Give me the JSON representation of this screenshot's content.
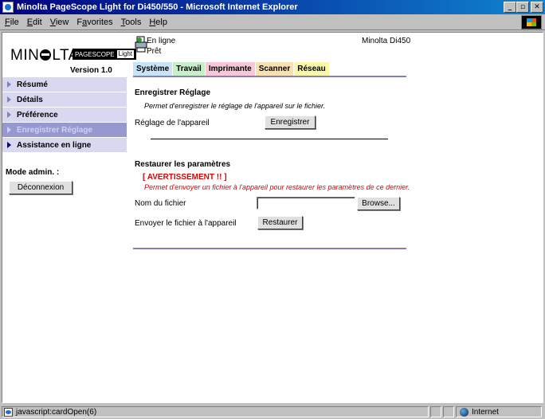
{
  "window": {
    "title": "Minolta PageScope Light for Di450/550 - Microsoft Internet Explorer"
  },
  "menu": [
    {
      "label": "File",
      "u": "F",
      "rest": "ile"
    },
    {
      "label": "Edit",
      "u": "E",
      "rest": "dit"
    },
    {
      "label": "View",
      "u": "V",
      "rest": "iew"
    },
    {
      "label": "Favorites",
      "pre": "F",
      "u": "a",
      "rest": "vorites"
    },
    {
      "label": "Tools",
      "u": "T",
      "rest": "ools"
    },
    {
      "label": "Help",
      "u": "H",
      "rest": "elp"
    }
  ],
  "header": {
    "logo_pre": "MIN",
    "logo_post": "LTA",
    "badge": "PAGESCOPE",
    "badge_light": "Light",
    "version": "Version 1.0",
    "status_line1": "En ligne",
    "status_line2": "Prêt",
    "model": "Minolta Di450"
  },
  "sidebar": {
    "items": [
      {
        "label": "Résumé"
      },
      {
        "label": "Détails"
      },
      {
        "label": "Préférence"
      },
      {
        "label": "Enregistrer Réglage"
      },
      {
        "label": "Assistance en ligne"
      }
    ],
    "admin_label": "Mode admin. :",
    "logout_label": "Déconnexion"
  },
  "tabs": [
    "Système",
    "Travail",
    "Imprimante",
    "Scanner",
    "Réseau"
  ],
  "save_section": {
    "title": "Enregistrer Réglage",
    "note": "Permet d'enregistrer le réglage de l'appareil sur le fichier.",
    "row_label": "Réglage de l'appareil",
    "button": "Enregistrer"
  },
  "restore_section": {
    "title": "Restaurer les paramètres",
    "warning_title": "[ AVERTISSEMENT !! ]",
    "warning_text": "Permet d'envoyer un fichier à l'appareil pour restaurer les paramètres de ce dernier.",
    "file_label": "Nom du fichier",
    "file_value": "",
    "browse_button": "Browse...",
    "send_label": "Envoyer le fichier à l'appareil",
    "restore_button": "Restaurer"
  },
  "statusbar": {
    "text": "javascript:cardOpen(6)",
    "zone": "Internet"
  }
}
